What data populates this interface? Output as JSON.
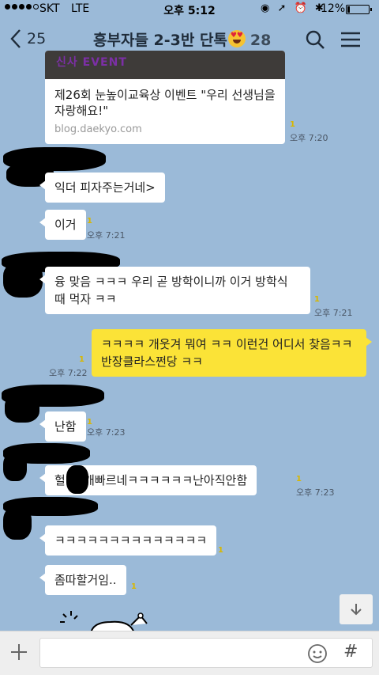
{
  "status_bar": {
    "carrier": "SKT",
    "network": "LTE",
    "time": "오후 5:12",
    "battery_percent": "12%",
    "battery_level": 0.12
  },
  "header": {
    "back_count": "25",
    "title": "흥부자들 2-3반 단톡",
    "member_count": "28",
    "icons": [
      "search-icon",
      "menu-icon"
    ]
  },
  "link_card": {
    "banner_text": "신사 EVENT",
    "title": "제26회 눈높이교육상 이벤트 \"우리 선생님을 자랑해요!\"",
    "url": "blog.daekyo.com",
    "unread": "1",
    "time": "오후 7:20"
  },
  "messages": [
    {
      "text": "익더 피자주는거네>",
      "unread": "",
      "time": ""
    },
    {
      "text": "이거",
      "unread": "1",
      "time": "오후 7:21"
    },
    {
      "text": "융 맞음 ㅋㅋㅋ 우리 곧 방학이니까 이거 방학식 때 먹자 ㅋㅋ",
      "unread": "1",
      "time": "오후 7:21"
    },
    {
      "text": "ㅋㅋㅋㅋ 개웃겨 뭐여 ㅋㅋ 이런건 어디서 찾음ㅋㅋ 반장클라스쩐당 ㅋㅋ",
      "unread": "1",
      "time": "오후 7:22",
      "mine": true
    },
    {
      "text": "난함",
      "unread": "1",
      "time": "오후 7:23"
    },
    {
      "text": "헐 이 개빠르네ㅋㅋㅋㅋㅋㅋ난아직안함",
      "unread": "1",
      "time": "오후 7:23"
    },
    {
      "text": "ㅋㅋㅋㅋㅋㅋㅋㅋㅋㅋㅋㅋㅋㅋ",
      "unread": "1",
      "time": ""
    },
    {
      "text": "좀따할거임..",
      "unread": "1",
      "time": ""
    }
  ],
  "input": {
    "placeholder": "",
    "hash_label": "#"
  },
  "colors": {
    "chat_background": "#9bbad8",
    "my_bubble": "#fbe337",
    "other_bubble": "#ffffff",
    "unread_count": "#d8b700"
  }
}
